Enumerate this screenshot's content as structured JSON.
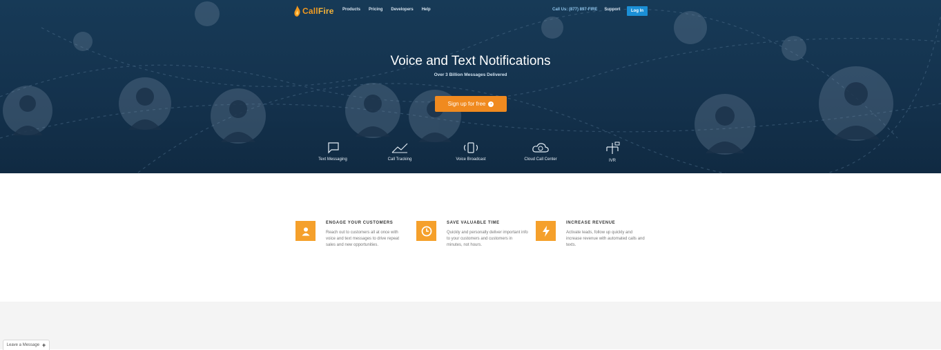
{
  "colors": {
    "hero_bg": "#14324d",
    "accent_orange": "#f08a1f",
    "login_blue": "#1b8fd6",
    "benefit_icon_bg": "#f5a02b"
  },
  "nav": {
    "logo_call": "Call",
    "logo_fire": "Fire",
    "links": [
      "Products",
      "Pricing",
      "Developers",
      "Help"
    ],
    "phone": "Call Us: (877) 897-FIRE",
    "support": "Support",
    "login": "Log In"
  },
  "hero": {
    "title": "Voice and Text Notifications",
    "subtitle": "Over 3 Billion Messages Delivered",
    "cta": "Sign up for free"
  },
  "features": [
    {
      "label": "Text Messaging",
      "icon": "chat-bubble-icon"
    },
    {
      "label": "Call Tracking",
      "icon": "chart-line-icon"
    },
    {
      "label": "Voice Broadcast",
      "icon": "broadcast-phone-icon"
    },
    {
      "label": "Cloud Call Center",
      "icon": "cloud-headset-icon"
    },
    {
      "label": "IVR",
      "icon": "flow-diagram-icon"
    }
  ],
  "benefits": [
    {
      "title": "ENGAGE YOUR CUSTOMERS",
      "text": "Reach out to customers all at once with voice and text messages to drive repeat sales and new opportunities.",
      "icon": "person-icon"
    },
    {
      "title": "SAVE VALUABLE TIME",
      "text": "Quickly and personally deliver important info to your customers and customers in minutes, not hours.",
      "icon": "clock-icon"
    },
    {
      "title": "INCREASE REVENUE",
      "text": "Activate leads, follow up quickly and increase revenue with automated calls and texts.",
      "icon": "lightning-icon"
    }
  ],
  "offline_tab": {
    "label": "Leave a Message",
    "plus": "+"
  }
}
